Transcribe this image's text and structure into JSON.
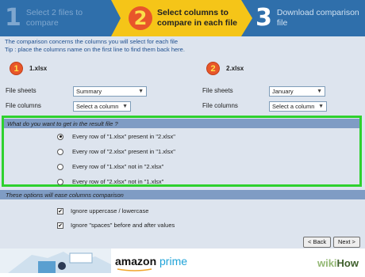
{
  "steps": [
    {
      "number": "1",
      "label_line1": "Select 2 files to",
      "label_line2": "compare"
    },
    {
      "number": "2",
      "label_line1": "Select columns to",
      "label_line2": "compare in each file"
    },
    {
      "number": "3",
      "label_line1": "Download comparison",
      "label_line2": "file"
    }
  ],
  "intro": {
    "line1": "The comparison concerns the columns you will select for each file",
    "line2": "Tip : place the columns name on the first line to find them back here."
  },
  "files": [
    {
      "badge": "1",
      "name": "1.xlsx",
      "sheets_label": "File sheets",
      "sheet_value": "Summary",
      "columns_label": "File columns",
      "column_value": "Select a column"
    },
    {
      "badge": "2",
      "name": "2.xlsx",
      "sheets_label": "File sheets",
      "sheet_value": "January",
      "columns_label": "File columns",
      "column_value": "Select a column"
    }
  ],
  "result": {
    "question": "What do you want to get in the result file ?",
    "options": [
      {
        "label": "Every row of \"1.xlsx\" present in \"2.xlsx\"",
        "selected": true
      },
      {
        "label": "Every row of \"2.xlsx\" present in \"1.xlsx\"",
        "selected": false
      },
      {
        "label": "Every row of \"1.xlsx\" not in \"2.xlsx\"",
        "selected": false
      },
      {
        "label": "Every row of \"2.xlsx\" not in \"1.xlsx\"",
        "selected": false
      }
    ]
  },
  "options_section": {
    "title": "These options will ease columns comparison",
    "checks": [
      {
        "label": "Ignore uppercase / lowercase",
        "checked": true
      },
      {
        "label": "Ignore \"spaces\" before and after values",
        "checked": true
      }
    ]
  },
  "nav": {
    "back": "< Back",
    "next": "Next >"
  },
  "ad": {
    "brand": "amazon",
    "brand2": "prime"
  },
  "watermark": {
    "part1": "wiki",
    "part2": "How"
  },
  "colors": {
    "header_blue": "#2f6fab",
    "active_step": "#f5c518",
    "highlight_green": "#2ed12e",
    "badge_orange": "#e8562a"
  }
}
